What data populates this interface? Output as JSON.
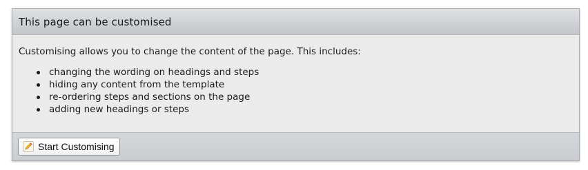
{
  "panel": {
    "title": "This page can be customised",
    "intro": "Customising allows you to change the content of the page. This includes:",
    "items": [
      {
        "label": "changing the wording on headings and steps"
      },
      {
        "label": "hiding any content from the template"
      },
      {
        "label": "re-ordering steps and sections on the page"
      },
      {
        "label": "adding new headings or steps"
      }
    ],
    "button": {
      "label": "Start Customising",
      "icon": "pencil-icon"
    }
  },
  "colors": {
    "panel_background": "#ebebeb",
    "header_background": "#cfd2d5",
    "border": "#a9acb0",
    "pencil_body": "#f2b632"
  }
}
